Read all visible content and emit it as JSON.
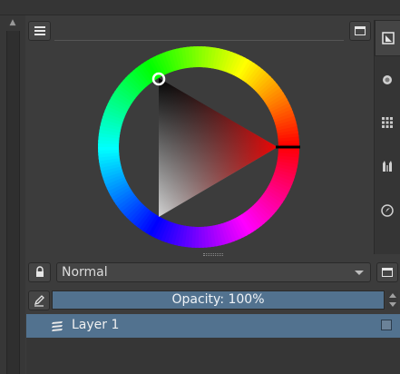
{
  "colors": {
    "panel_bg": "#3c3c3c",
    "selection": "#52728f",
    "text": "#d8d8d8"
  },
  "toolbar": {
    "menu_icon": "hamburger-icon",
    "float_icon": "window-icon"
  },
  "color_selector": {
    "type": "hue-ring with saturation/value triangle",
    "hue_cursor_color": "#000000",
    "selected_hue": "red",
    "selected_color": "#7fff00"
  },
  "side_tabs": [
    {
      "icon": "color-selector-icon"
    },
    {
      "icon": "circle-brush-icon"
    },
    {
      "icon": "palette-grid-icon"
    },
    {
      "icon": "brush-preset-icon"
    },
    {
      "icon": "compass-icon"
    }
  ],
  "layers": {
    "blend_mode": "Normal",
    "opacity_label": "Opacity:  100%",
    "items": [
      {
        "name": "Layer 1",
        "selected": true
      }
    ]
  }
}
